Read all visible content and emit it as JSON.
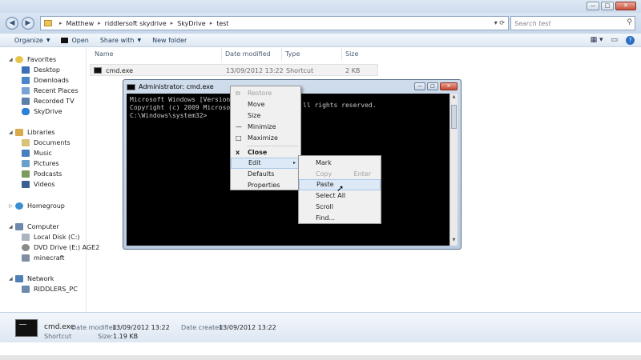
{
  "explorer": {
    "breadcrumb": [
      "Matthew",
      "riddlersoft skydrive",
      "SkyDrive",
      "test"
    ],
    "search_placeholder": "Search test",
    "toolbar": {
      "organize": "Organize",
      "open": "Open",
      "share_with": "Share with",
      "new_folder": "New folder"
    },
    "columns": {
      "name": "Name",
      "date": "Date modified",
      "type": "Type",
      "size": "Size"
    },
    "file": {
      "name": "cmd.exe",
      "date": "13/09/2012 13:22",
      "type": "Shortcut",
      "size": "2 KB"
    },
    "nav": {
      "favorites": "Favorites",
      "favorites_items": [
        "Desktop",
        "Downloads",
        "Recent Places",
        "Recorded TV",
        "SkyDrive"
      ],
      "libraries": "Libraries",
      "libraries_items": [
        "Documents",
        "Music",
        "Pictures",
        "Podcasts",
        "Videos"
      ],
      "homegroup": "Homegroup",
      "computer": "Computer",
      "computer_items": [
        "Local Disk (C:)",
        "DVD Drive (E:) AGE2",
        "minecraft"
      ],
      "network": "Network",
      "network_items": [
        "RIDDLERS_PC"
      ]
    },
    "details": {
      "name": "cmd.exe",
      "date_modified_label": "Date modified:",
      "date_modified": "13/09/2012 13:22",
      "date_created_label": "Date created:",
      "date_created": "13/09/2012 13:22",
      "type": "Shortcut",
      "size_label": "Size:",
      "size": "1.19 KB"
    }
  },
  "cmd": {
    "title": "Administrator: cmd.exe",
    "lines": [
      "Microsoft Windows [Version",
      "Copyright (c) 2009 Microso",
      "",
      "C:\\Windows\\system32>"
    ],
    "line1_tail": "ll rights reserved."
  },
  "system_menu": {
    "items": [
      {
        "label": "Restore",
        "glyph": "⧉",
        "disabled": true
      },
      {
        "label": "Move",
        "glyph": "",
        "disabled": false
      },
      {
        "label": "Size",
        "glyph": "",
        "disabled": false
      },
      {
        "label": "Minimize",
        "glyph": "—",
        "disabled": false
      },
      {
        "label": "Maximize",
        "glyph": "□",
        "disabled": false
      },
      {
        "label": "Close",
        "glyph": "x",
        "disabled": false
      },
      {
        "label": "Edit",
        "glyph": "",
        "disabled": false,
        "submenu_arrow": "▸"
      },
      {
        "label": "Defaults",
        "glyph": "",
        "disabled": false
      },
      {
        "label": "Properties",
        "glyph": "",
        "disabled": false
      }
    ]
  },
  "edit_menu": {
    "items": [
      {
        "label": "Mark",
        "accel": ""
      },
      {
        "label": "Copy",
        "accel": "Enter",
        "disabled": true
      },
      {
        "label": "Paste",
        "accel": ""
      },
      {
        "label": "Select All",
        "accel": ""
      },
      {
        "label": "Scroll",
        "accel": ""
      },
      {
        "label": "Find...",
        "accel": ""
      }
    ]
  },
  "colors": {
    "accent": "#3a6fb0",
    "highlight": "#dde9f7",
    "console_bg": "#000000",
    "console_fg": "#c8c8c8"
  }
}
